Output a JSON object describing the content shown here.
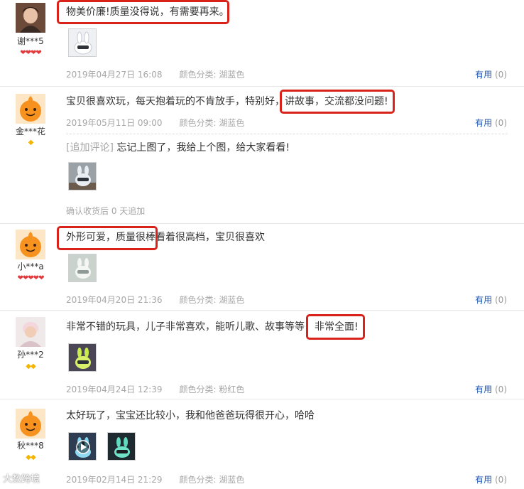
{
  "useful_label": "有用",
  "color_label": "颜色分类:",
  "watermark": "大数跨境",
  "reviews": [
    {
      "username": "谢***5",
      "badges": "❤❤❤❤",
      "text": "物美价廉!质量没得说，有需要再来。",
      "date": "2019年04月27日 16:08",
      "color": "湖蓝色",
      "useful_count": "(0)"
    },
    {
      "username": "金***花",
      "badges": "◆",
      "text": "宝贝很喜欢玩，每天抱着玩的不肯放手，特别好，讲故事，交流都没问题!",
      "date": "2019年05月11日 09:00",
      "color": "湖蓝色",
      "useful_count": "(0)",
      "append_tag": "[追加评论]",
      "append_text": "忘记上图了，我给上个图，给大家看看!",
      "append_note": "确认收货后 0 天追加"
    },
    {
      "username": "小***a",
      "badges": "❤❤❤❤❤",
      "text": "外形可爱，质量很棒看着很高档，宝贝很喜欢",
      "date": "2019年04月20日 21:36",
      "color": "湖蓝色",
      "useful_count": "(0)"
    },
    {
      "username": "孙***2",
      "badges": "◆◆",
      "text": "非常不错的玩具，儿子非常喜欢，能听儿歌、故事等等，非常全面!",
      "date": "2019年04月24日 12:39",
      "color": "粉红色",
      "useful_count": "(0)"
    },
    {
      "username": "秋***8",
      "badges": "◆◆",
      "text": "太好玩了，宝宝还比较小，我和他爸爸玩得很开心，哈哈",
      "date": "2019年02月14日 21:29",
      "color": "湖蓝色",
      "useful_count": "(0)"
    }
  ]
}
